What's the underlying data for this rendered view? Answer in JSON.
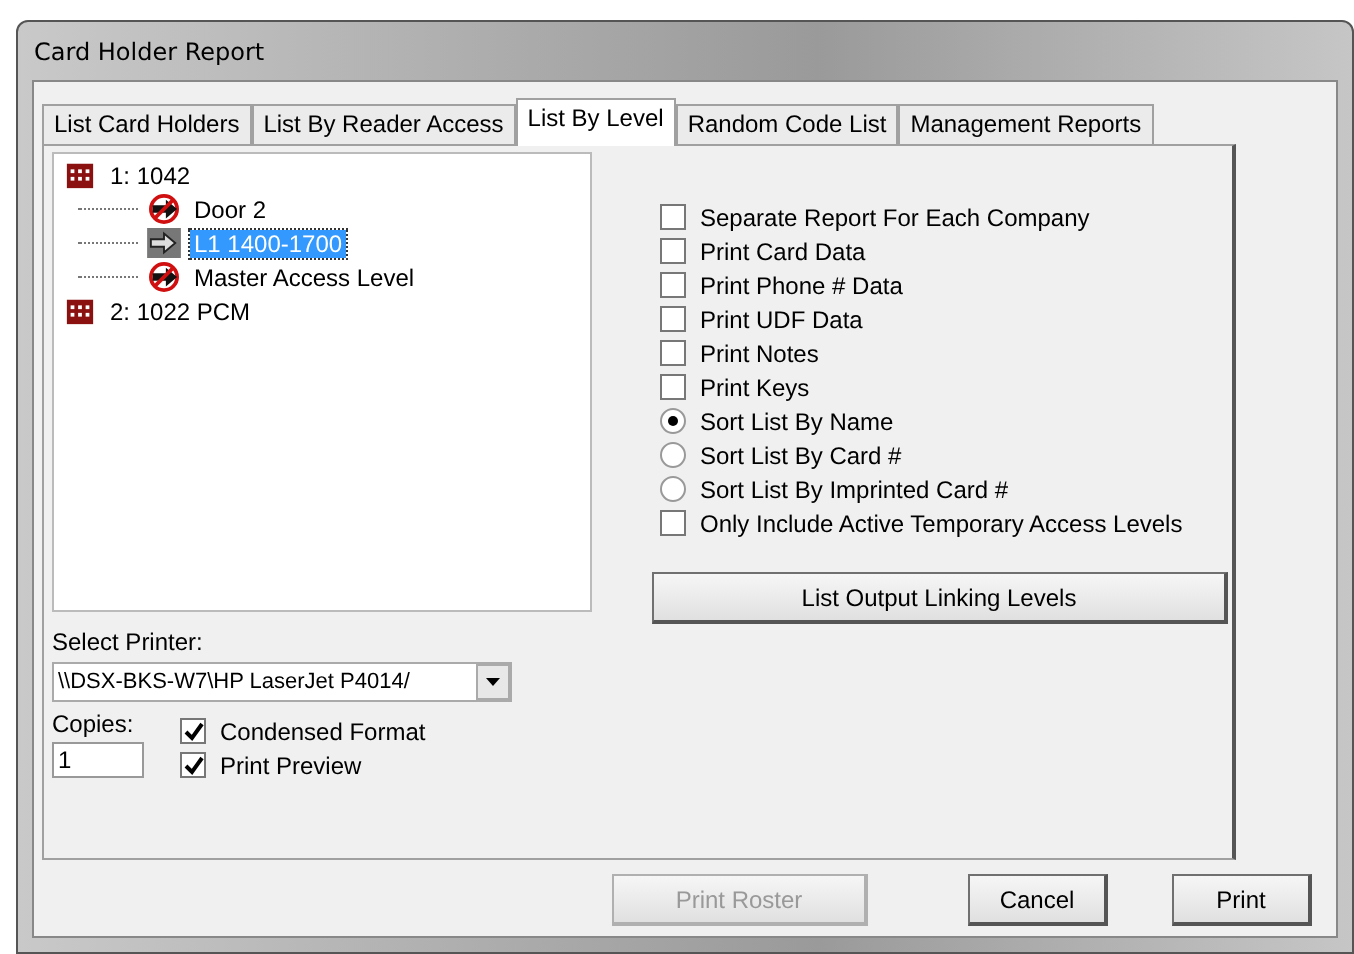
{
  "window": {
    "title": "Card Holder Report"
  },
  "tabs": [
    {
      "label": "List Card Holders",
      "selected": false
    },
    {
      "label": "List By Reader Access",
      "selected": false
    },
    {
      "label": "List By Level",
      "selected": true
    },
    {
      "label": "Random Code List",
      "selected": false
    },
    {
      "label": "Management Reports",
      "selected": false
    }
  ],
  "tree": [
    {
      "label": "1:  1042",
      "kind": "site",
      "selected": false,
      "children": [
        {
          "label": "Door 2",
          "kind": "door",
          "selected": false
        },
        {
          "label": "L1 1400-1700",
          "kind": "level",
          "selected": true
        },
        {
          "label": "Master Access Level",
          "kind": "door",
          "selected": false
        }
      ]
    },
    {
      "label": "2:  1022 PCM",
      "kind": "site",
      "selected": false
    }
  ],
  "options": [
    {
      "kind": "checkbox",
      "label": "Separate Report For Each Company",
      "checked": false
    },
    {
      "kind": "checkbox",
      "label": "Print Card Data",
      "checked": false
    },
    {
      "kind": "checkbox",
      "label": "Print Phone # Data",
      "checked": false
    },
    {
      "kind": "checkbox",
      "label": "Print UDF Data",
      "checked": false
    },
    {
      "kind": "checkbox",
      "label": "Print Notes",
      "checked": false
    },
    {
      "kind": "checkbox",
      "label": "Print Keys",
      "checked": false
    },
    {
      "kind": "radio",
      "label": "Sort List By Name",
      "checked": true
    },
    {
      "kind": "radio",
      "label": "Sort List By Card #",
      "checked": false
    },
    {
      "kind": "radio",
      "label": "Sort List By Imprinted Card #",
      "checked": false
    },
    {
      "kind": "checkbox",
      "label": "Only Include Active Temporary Access Levels",
      "checked": false
    }
  ],
  "linking_button": "List Output Linking Levels",
  "printer": {
    "label": "Select Printer:",
    "value": "\\\\DSX-BKS-W7\\HP LaserJet P4014/"
  },
  "copies": {
    "label": "Copies:",
    "value": "1"
  },
  "print_options": [
    {
      "label": "Condensed Format",
      "checked": true
    },
    {
      "label": "Print Preview",
      "checked": true
    }
  ],
  "buttons": [
    {
      "label": "Print Roster",
      "disabled": true
    },
    {
      "label": "Cancel",
      "disabled": false
    },
    {
      "label": "Print",
      "disabled": false
    }
  ]
}
